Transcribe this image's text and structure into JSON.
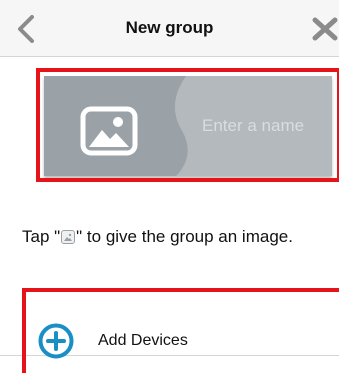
{
  "header": {
    "title": "New group",
    "back_icon": "chevron-left-icon",
    "close_icon": "close-x-icon"
  },
  "group_card": {
    "image_icon": "image-placeholder-icon",
    "name_placeholder": "Enter a name",
    "name_value": ""
  },
  "hint": {
    "prefix": "Tap \"",
    "suffix": "\" to give the group an image."
  },
  "add_devices": {
    "label": "Add Devices",
    "icon": "plus-circle-icon"
  },
  "colors": {
    "card_bg": "#b3b9bd",
    "accent": "#1a8fc4",
    "highlight": "#e5141b"
  }
}
